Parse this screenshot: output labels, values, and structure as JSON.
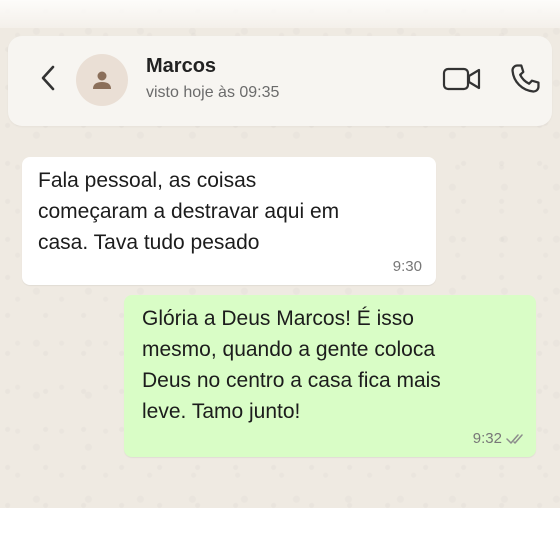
{
  "header": {
    "contact_name": "Marcos",
    "status": "visto hoje às 09:35",
    "icons": [
      "back-arrow-icon",
      "avatar-person-icon",
      "video-call-icon",
      "phone-icon"
    ]
  },
  "messages": [
    {
      "direction": "incoming",
      "text": "Fala pessoal, as coisas\ncomeçaram a destravar aqui em\ncasa. Tava tudo pesado",
      "time": "9:30"
    },
    {
      "direction": "outgoing",
      "text": "Glória a Deus Marcos! É isso\nmesmo, quando a gente coloca\nDeus no centro a casa fica mais\nleve. Tamo junto!",
      "time": "9:32",
      "status_icon": "double-check-icon"
    }
  ],
  "colors": {
    "chat_background": "#efeae2",
    "incoming_bubble": "#ffffff",
    "outgoing_bubble": "#d9fdc6",
    "header_background": "#f7f5f1"
  }
}
